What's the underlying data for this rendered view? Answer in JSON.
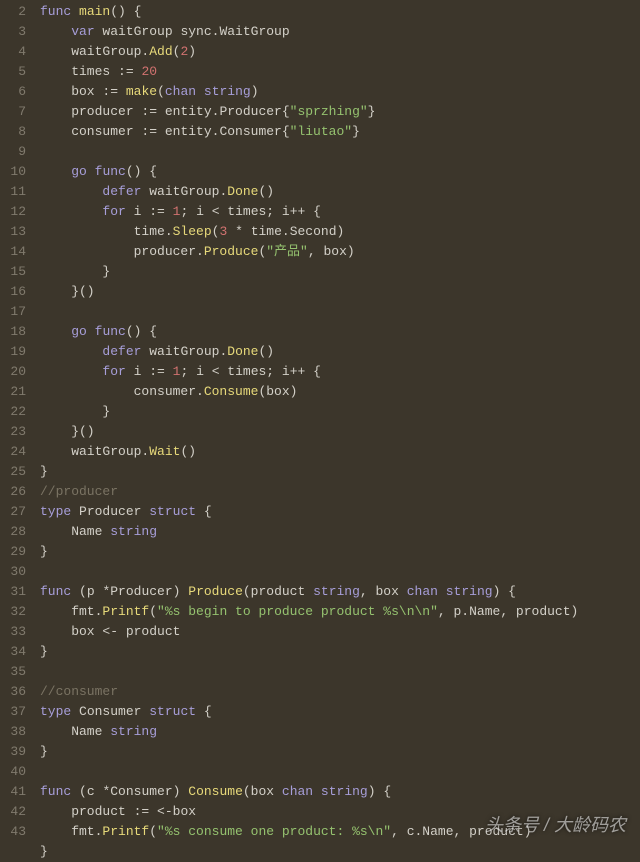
{
  "gutter": {
    "start": 2,
    "end": 43
  },
  "watermark": "头条号 / 大龄码农",
  "lines": [
    [
      [
        "kw",
        "func"
      ],
      [
        "punc",
        " "
      ],
      [
        "fn",
        "main"
      ],
      [
        "punc",
        "() {"
      ]
    ],
    [
      [
        "punc",
        "    "
      ],
      [
        "kw",
        "var"
      ],
      [
        "punc",
        " waitGroup sync.WaitGroup"
      ]
    ],
    [
      [
        "punc",
        "    waitGroup."
      ],
      [
        "fn",
        "Add"
      ],
      [
        "punc",
        "("
      ],
      [
        "num",
        "2"
      ],
      [
        "punc",
        ")"
      ]
    ],
    [
      [
        "punc",
        "    times "
      ],
      [
        "op",
        ":="
      ],
      [
        "punc",
        " "
      ],
      [
        "num",
        "20"
      ]
    ],
    [
      [
        "punc",
        "    box "
      ],
      [
        "op",
        ":="
      ],
      [
        "punc",
        " "
      ],
      [
        "fn",
        "make"
      ],
      [
        "punc",
        "("
      ],
      [
        "kw",
        "chan"
      ],
      [
        "punc",
        " "
      ],
      [
        "kw",
        "string"
      ],
      [
        "punc",
        ")"
      ]
    ],
    [
      [
        "punc",
        "    producer "
      ],
      [
        "op",
        ":="
      ],
      [
        "punc",
        " entity.Producer{"
      ],
      [
        "str",
        "\"sprzhing\""
      ],
      [
        "punc",
        "}"
      ]
    ],
    [
      [
        "punc",
        "    consumer "
      ],
      [
        "op",
        ":="
      ],
      [
        "punc",
        " entity.Consumer{"
      ],
      [
        "str",
        "\"liutao\""
      ],
      [
        "punc",
        "}"
      ]
    ],
    [
      [
        "punc",
        ""
      ]
    ],
    [
      [
        "punc",
        "    "
      ],
      [
        "kw",
        "go"
      ],
      [
        "punc",
        " "
      ],
      [
        "kw",
        "func"
      ],
      [
        "punc",
        "() {"
      ]
    ],
    [
      [
        "punc",
        "        "
      ],
      [
        "kw",
        "defer"
      ],
      [
        "punc",
        " waitGroup."
      ],
      [
        "fn",
        "Done"
      ],
      [
        "punc",
        "()"
      ]
    ],
    [
      [
        "punc",
        "        "
      ],
      [
        "kw",
        "for"
      ],
      [
        "punc",
        " i "
      ],
      [
        "op",
        ":="
      ],
      [
        "punc",
        " "
      ],
      [
        "num",
        "1"
      ],
      [
        "punc",
        "; i "
      ],
      [
        "op",
        "<"
      ],
      [
        "punc",
        " times; i"
      ],
      [
        "op",
        "++"
      ],
      [
        "punc",
        " {"
      ]
    ],
    [
      [
        "punc",
        "            time."
      ],
      [
        "fn",
        "Sleep"
      ],
      [
        "punc",
        "("
      ],
      [
        "num",
        "3"
      ],
      [
        "punc",
        " "
      ],
      [
        "op",
        "*"
      ],
      [
        "punc",
        " time.Second)"
      ]
    ],
    [
      [
        "punc",
        "            producer."
      ],
      [
        "fn",
        "Produce"
      ],
      [
        "punc",
        "("
      ],
      [
        "str",
        "\"产品\""
      ],
      [
        "punc",
        ", box)"
      ]
    ],
    [
      [
        "punc",
        "        }"
      ]
    ],
    [
      [
        "punc",
        "    }()"
      ]
    ],
    [
      [
        "punc",
        ""
      ]
    ],
    [
      [
        "punc",
        "    "
      ],
      [
        "kw",
        "go"
      ],
      [
        "punc",
        " "
      ],
      [
        "kw",
        "func"
      ],
      [
        "punc",
        "() {"
      ]
    ],
    [
      [
        "punc",
        "        "
      ],
      [
        "kw",
        "defer"
      ],
      [
        "punc",
        " waitGroup."
      ],
      [
        "fn",
        "Done"
      ],
      [
        "punc",
        "()"
      ]
    ],
    [
      [
        "punc",
        "        "
      ],
      [
        "kw",
        "for"
      ],
      [
        "punc",
        " i "
      ],
      [
        "op",
        ":="
      ],
      [
        "punc",
        " "
      ],
      [
        "num",
        "1"
      ],
      [
        "punc",
        "; i "
      ],
      [
        "op",
        "<"
      ],
      [
        "punc",
        " times; i"
      ],
      [
        "op",
        "++"
      ],
      [
        "punc",
        " {"
      ]
    ],
    [
      [
        "punc",
        "            consumer."
      ],
      [
        "fn",
        "Consume"
      ],
      [
        "punc",
        "(box)"
      ]
    ],
    [
      [
        "punc",
        "        }"
      ]
    ],
    [
      [
        "punc",
        "    }()"
      ]
    ],
    [
      [
        "punc",
        "    waitGroup."
      ],
      [
        "fn",
        "Wait"
      ],
      [
        "punc",
        "()"
      ]
    ],
    [
      [
        "punc",
        "}"
      ]
    ],
    [
      [
        "comment",
        "//producer"
      ]
    ],
    [
      [
        "kw",
        "type"
      ],
      [
        "punc",
        " Producer "
      ],
      [
        "kw",
        "struct"
      ],
      [
        "punc",
        " {"
      ]
    ],
    [
      [
        "punc",
        "    Name "
      ],
      [
        "kw",
        "string"
      ]
    ],
    [
      [
        "punc",
        "}"
      ]
    ],
    [
      [
        "punc",
        ""
      ]
    ],
    [
      [
        "kw",
        "func"
      ],
      [
        "punc",
        " (p "
      ],
      [
        "op",
        "*"
      ],
      [
        "punc",
        "Producer) "
      ],
      [
        "fn",
        "Produce"
      ],
      [
        "punc",
        "(product "
      ],
      [
        "kw",
        "string"
      ],
      [
        "punc",
        ", box "
      ],
      [
        "kw",
        "chan"
      ],
      [
        "punc",
        " "
      ],
      [
        "kw",
        "string"
      ],
      [
        "punc",
        ") {"
      ]
    ],
    [
      [
        "punc",
        "    fmt."
      ],
      [
        "fn",
        "Printf"
      ],
      [
        "punc",
        "("
      ],
      [
        "str",
        "\"%s begin to produce product %s\\n\\n\""
      ],
      [
        "punc",
        ", p.Name, product)"
      ]
    ],
    [
      [
        "punc",
        "    box "
      ],
      [
        "op",
        "<-"
      ],
      [
        "punc",
        " product"
      ]
    ],
    [
      [
        "punc",
        "}"
      ]
    ],
    [
      [
        "punc",
        ""
      ]
    ],
    [
      [
        "comment",
        "//consumer"
      ]
    ],
    [
      [
        "kw",
        "type"
      ],
      [
        "punc",
        " Consumer "
      ],
      [
        "kw",
        "struct"
      ],
      [
        "punc",
        " {"
      ]
    ],
    [
      [
        "punc",
        "    Name "
      ],
      [
        "kw",
        "string"
      ]
    ],
    [
      [
        "punc",
        "}"
      ]
    ],
    [
      [
        "punc",
        ""
      ]
    ],
    [
      [
        "kw",
        "func"
      ],
      [
        "punc",
        " (c "
      ],
      [
        "op",
        "*"
      ],
      [
        "punc",
        "Consumer) "
      ],
      [
        "fn",
        "Consume"
      ],
      [
        "punc",
        "(box "
      ],
      [
        "kw",
        "chan"
      ],
      [
        "punc",
        " "
      ],
      [
        "kw",
        "string"
      ],
      [
        "punc",
        ") {"
      ]
    ],
    [
      [
        "punc",
        "    product "
      ],
      [
        "op",
        ":="
      ],
      [
        "punc",
        " "
      ],
      [
        "op",
        "<-"
      ],
      [
        "punc",
        "box"
      ]
    ],
    [
      [
        "punc",
        "    fmt."
      ],
      [
        "fn",
        "Printf"
      ],
      [
        "punc",
        "("
      ],
      [
        "str",
        "\"%s consume one product: %s\\n\""
      ],
      [
        "punc",
        ", c.Name, product)"
      ]
    ],
    [
      [
        "punc",
        "}"
      ]
    ]
  ]
}
